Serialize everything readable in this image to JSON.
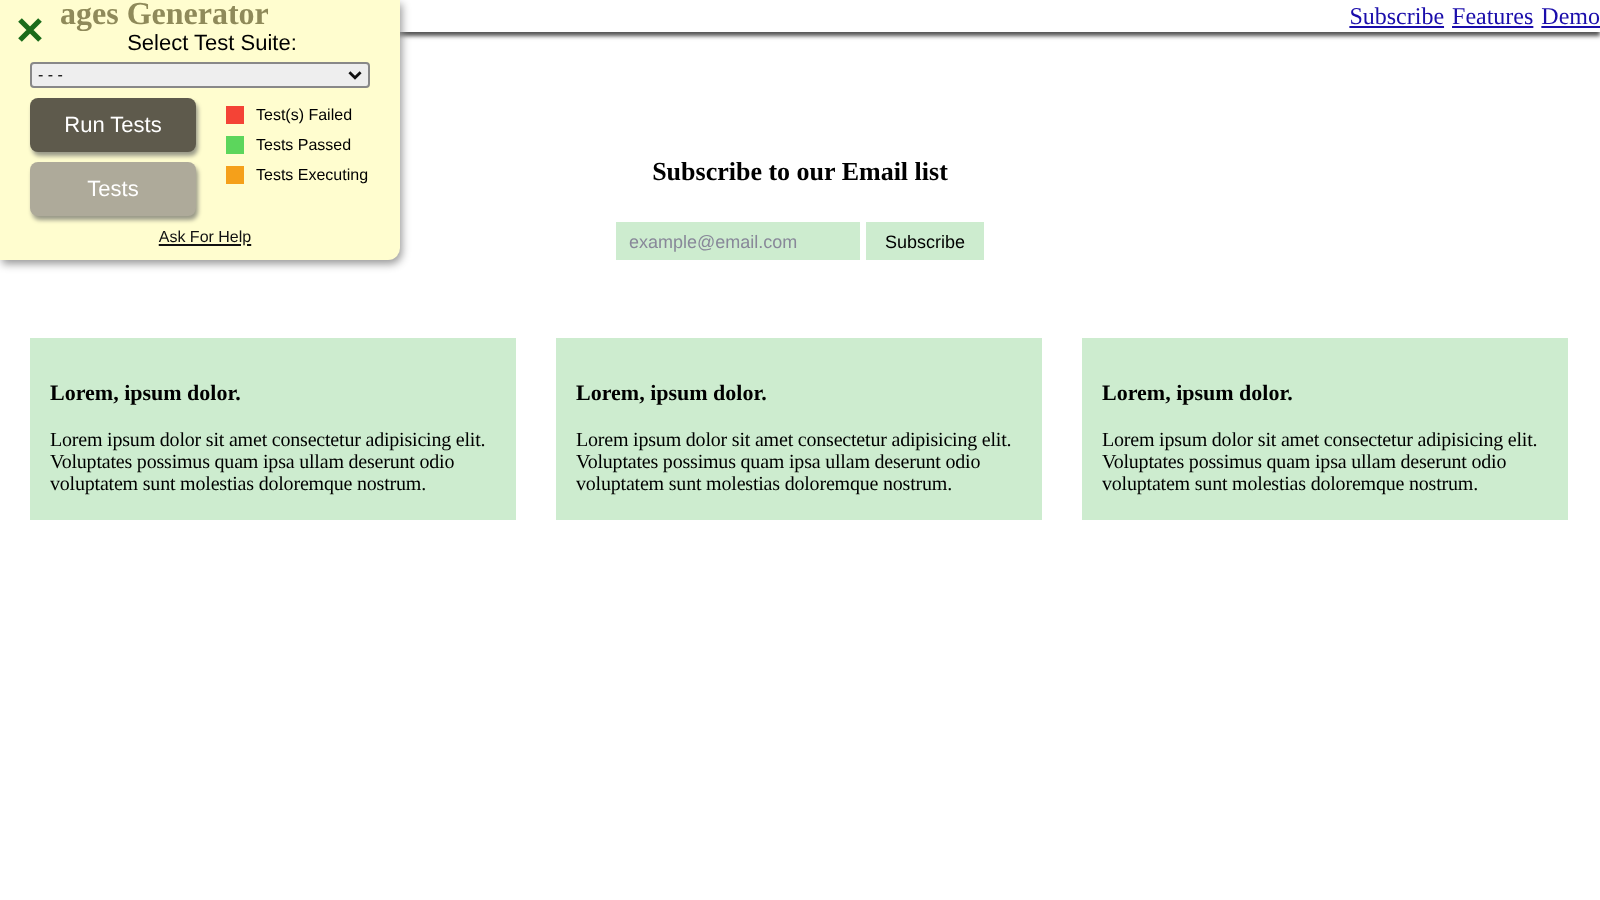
{
  "header": {
    "title": "ages Generator",
    "links": [
      "Subscribe",
      "Features",
      "Demo"
    ]
  },
  "panel": {
    "label": "Select Test Suite:",
    "select_value": "- - -",
    "buttons": [
      {
        "label": "Run Tests",
        "kind": "primary"
      },
      {
        "label": "Tests",
        "kind": "secondary"
      }
    ],
    "legend": [
      {
        "label": "Test(s) Failed",
        "color": "#f44336"
      },
      {
        "label": "Tests Passed",
        "color": "#5cd65c"
      },
      {
        "label": "Tests Executing",
        "color": "#f5a01a"
      }
    ],
    "help_link": "Ask For Help"
  },
  "subscribe": {
    "heading": "Subscribe to our Email list",
    "placeholder": "example@email.com",
    "button": "Subscribe"
  },
  "cards": [
    {
      "title": "Lorem, ipsum dolor.",
      "text": "Lorem ipsum dolor sit amet consectetur adipisicing elit. Voluptates possimus quam ipsa ullam deserunt odio voluptatem sunt molestias doloremque nostrum."
    },
    {
      "title": "Lorem, ipsum dolor.",
      "text": "Lorem ipsum dolor sit amet consectetur adipisicing elit. Voluptates possimus quam ipsa ullam deserunt odio voluptatem sunt molestias doloremque nostrum."
    },
    {
      "title": "Lorem, ipsum dolor.",
      "text": "Lorem ipsum dolor sit amet consectetur adipisicing elit. Voluptates possimus quam ipsa ullam deserunt odio voluptatem sunt molestias doloremque nostrum."
    }
  ]
}
